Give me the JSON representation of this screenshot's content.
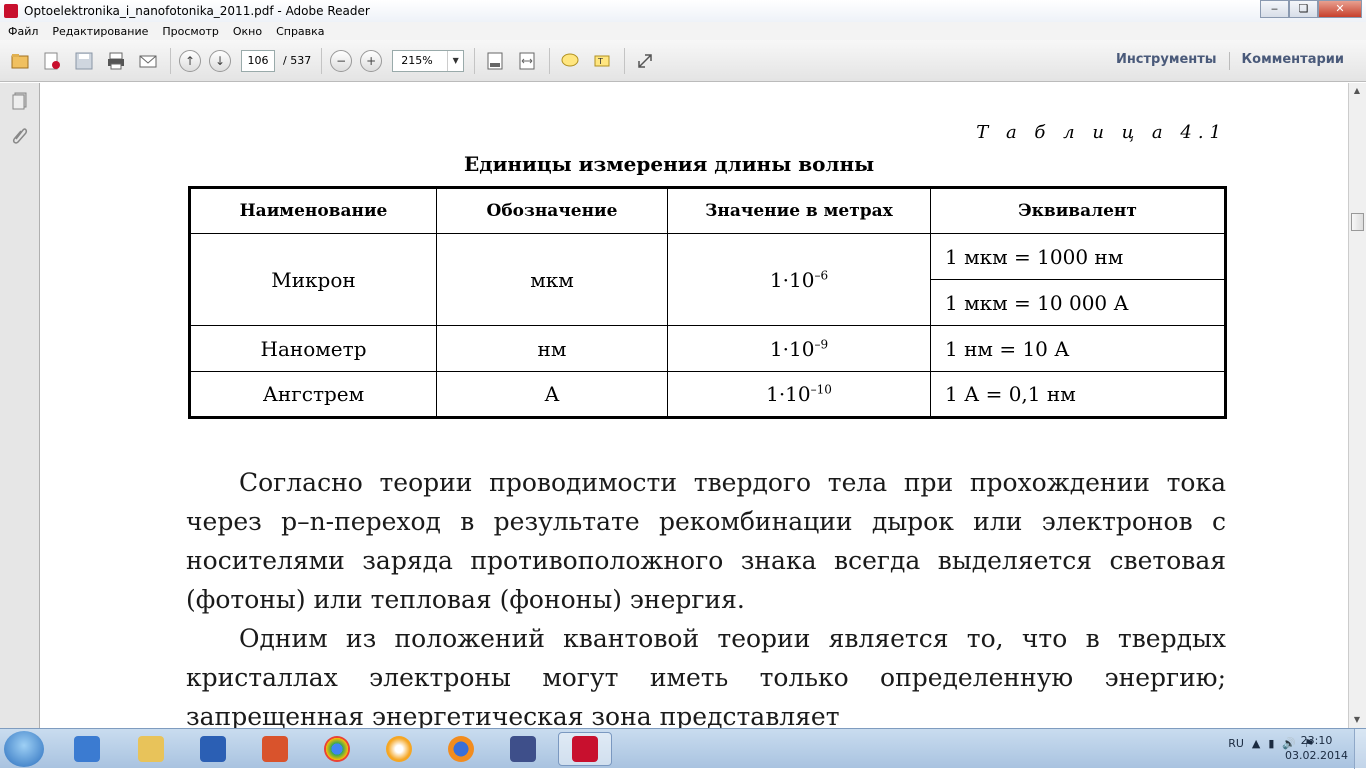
{
  "window": {
    "title": "Optoelektronika_i_nanofotonika_2011.pdf - Adobe Reader",
    "minimize": "‒",
    "maximize": "❏",
    "close": "✕"
  },
  "menu": [
    "Файл",
    "Редактирование",
    "Просмотр",
    "Окно",
    "Справка"
  ],
  "toolbar": {
    "page_current": "106",
    "page_total": "/ 537",
    "zoom": "215%",
    "tools_label": "Инструменты",
    "comments_label": "Комментарии"
  },
  "document": {
    "table_caption": "Т а б л и ц а   4.1",
    "table_title": "Единицы измерения длины волны",
    "table_headers": [
      "Наименование",
      "Обозначение",
      "Значение в метрах",
      "Эквивалент"
    ],
    "rows": [
      {
        "name": "Микрон",
        "symbol": "мкм",
        "value_base": "1·10",
        "value_exp": "–6",
        "equiv": [
          "1 мкм = 1000 нм",
          "1 мкм = 10 000 А"
        ]
      },
      {
        "name": "Нанометр",
        "symbol": "нм",
        "value_base": "1·10",
        "value_exp": "–9",
        "equiv": [
          "1 нм = 10 А"
        ]
      },
      {
        "name": "Ангстрем",
        "symbol": "А",
        "value_base": "1·10",
        "value_exp": "–10",
        "equiv": [
          "1 А = 0,1 нм"
        ]
      }
    ],
    "paragraph1": "Согласно теории проводимости твердого тела при прохождении тока через p–n-переход в результате рекомбинации дырок или электронов с носителями заряда противоположного знака всегда выделяется световая (фотоны) или тепловая (фононы) энергия.",
    "paragraph2": "Одним из положений квантовой теории является то, что в твердых кристаллах электроны могут иметь только определенную энергию; запрещенная энергетическая зона представляет"
  },
  "taskbar": {
    "lang": "RU",
    "time": "23:10",
    "date": "03.02.2014"
  },
  "colors": {
    "accent_taskbar": "#a9c3e0",
    "pdf_red": "#c8102e"
  }
}
